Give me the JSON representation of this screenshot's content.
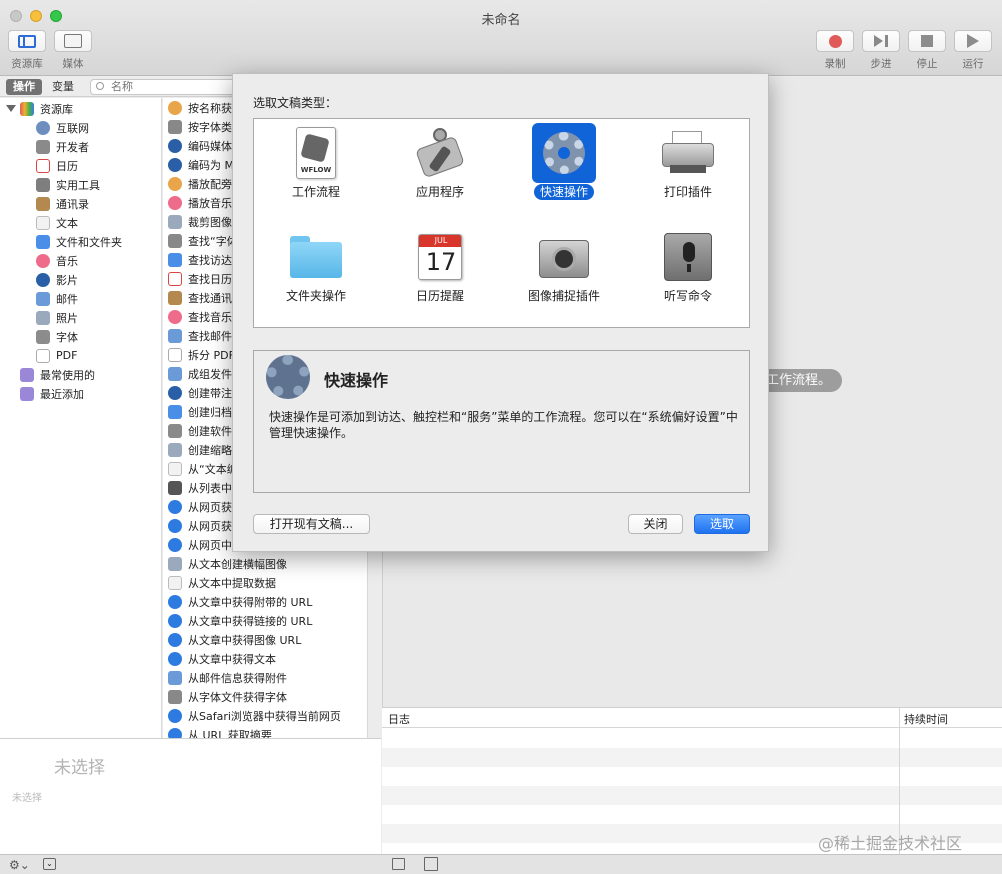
{
  "window": {
    "title": "未命名"
  },
  "toolbar": {
    "left": [
      {
        "label": "资源库",
        "icon": "library-icon"
      },
      {
        "label": "媒体",
        "icon": "media-icon"
      }
    ],
    "right": [
      {
        "label": "录制",
        "icon": "record-icon"
      },
      {
        "label": "步进",
        "icon": "step-icon"
      },
      {
        "label": "停止",
        "icon": "stop-icon"
      },
      {
        "label": "运行",
        "icon": "run-icon"
      }
    ]
  },
  "library": {
    "tabs": [
      "操作",
      "变量"
    ],
    "search_placeholder": "名称",
    "root": "资源库",
    "categories": [
      "互联网",
      "开发者",
      "日历",
      "实用工具",
      "通讯录",
      "文本",
      "文件和文件夹",
      "音乐",
      "影片",
      "邮件",
      "照片",
      "字体",
      "PDF"
    ],
    "smart_groups": [
      "最常使用的",
      "最近添加"
    ],
    "actions": [
      "按名称获",
      "按字体类",
      "编码媒体",
      "编码为 M",
      "播放配旁",
      "播放音乐",
      "裁剪图像",
      "查找“字体",
      "查找访达",
      "查找日历",
      "查找通讯",
      "查找音乐",
      "查找邮件",
      "拆分 PDF",
      "成组发件",
      "创建带注",
      "创建归档",
      "创建软件",
      "创建缩略",
      "从“文本编",
      "从列表中",
      "从网页获",
      "从网页获",
      "从网页中",
      "从文本创建横幅图像",
      "从文本中提取数据",
      "从文章中获得附带的 URL",
      "从文章中获得链接的 URL",
      "从文章中获得图像 URL",
      "从文章中获得文本",
      "从邮件信息获得附件",
      "从字体文件获得字体",
      "从Safari浏览器中获得当前网页",
      "从 URL 获取摘要"
    ]
  },
  "info_pane": {
    "title": "未选择",
    "subtitle": "未选择"
  },
  "workflow": {
    "hint": "工作流程。"
  },
  "log": {
    "col_log": "日志",
    "col_duration": "持续时间"
  },
  "sheet": {
    "title": "选取文稿类型：",
    "types": [
      {
        "label": "工作流程",
        "icon": "workflow-icon"
      },
      {
        "label": "应用程序",
        "icon": "application-icon"
      },
      {
        "label": "快速操作",
        "icon": "gear-icon"
      },
      {
        "label": "打印插件",
        "icon": "printer-icon"
      },
      {
        "label": "文件夹操作",
        "icon": "folder-icon"
      },
      {
        "label": "日历提醒",
        "icon": "calendar-icon"
      },
      {
        "label": "图像捕捉插件",
        "icon": "camera-icon"
      },
      {
        "label": "听写命令",
        "icon": "microphone-icon"
      }
    ],
    "selected_type": "快速操作",
    "calendar_month": "JUL",
    "calendar_day": "17",
    "workflow_badge": "WFLOW",
    "description": {
      "title": "快速操作",
      "text": "快速操作是可添加到访达、触控栏和“服务”菜单的工作流程。您可以在“系统偏好设置”中管理快速操作。"
    },
    "buttons": {
      "open_existing": "打开现有文稿...",
      "close": "关闭",
      "choose": "选取"
    }
  },
  "watermark": "@稀土掘金技术社区"
}
